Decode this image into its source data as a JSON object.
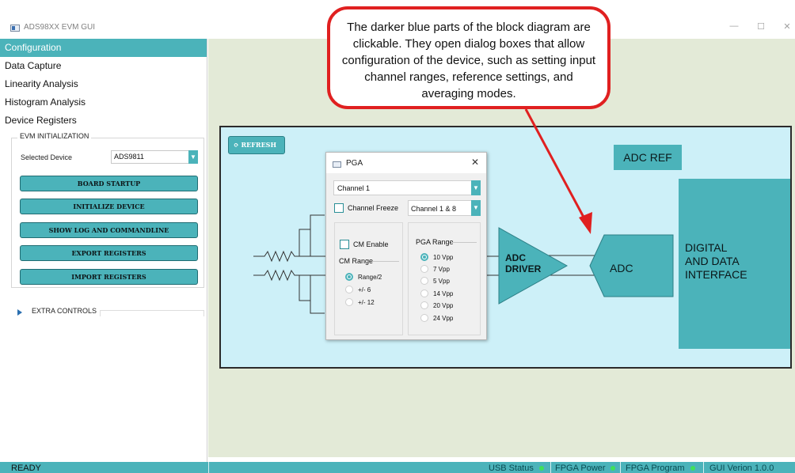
{
  "window": {
    "title": "ADS98XX EVM GUI",
    "minimize": "—",
    "maximize": "☐",
    "close": "✕"
  },
  "nav": {
    "items": [
      "Configuration",
      "Data Capture",
      "Linearity Analysis",
      "Histogram Analysis",
      "Device Registers"
    ],
    "active": "Configuration"
  },
  "evm_init": {
    "legend": "EVM INITIALIZATION",
    "selected_device_label": "Selected Device",
    "selected_device_value": "ADS9811",
    "buttons": [
      "BOARD STARTUP",
      "INITIALIZE DEVICE",
      "SHOW LOG AND COMMANDLINE",
      "EXPORT REGISTERS",
      "IMPORT REGISTERS"
    ]
  },
  "extra_controls": "EXTRA CONTROLS",
  "diagram": {
    "refresh": "REFRESH",
    "adc_ref": "ADC REF",
    "adc_driver": [
      "ADC",
      "DRIVER"
    ],
    "adc": "ADC",
    "digital": [
      "DIGITAL",
      "AND DATA",
      "INTERFACE"
    ]
  },
  "pga_dialog": {
    "title": "PGA",
    "close": "✕",
    "channel": "Channel 1",
    "channel_freeze": "Channel Freeze",
    "channel_pair": "Channel 1 & 8",
    "cm_enable": "CM Enable",
    "cm_range_label": "CM Range",
    "cm_range_options": [
      "Range/2",
      "+/- 6",
      "+/- 12"
    ],
    "cm_range_selected": "Range/2",
    "pga_range_label": "PGA Range",
    "pga_range_options": [
      "10 Vpp",
      "7 Vpp",
      "5 Vpp",
      "14 Vpp",
      "20 Vpp",
      "24 Vpp"
    ],
    "pga_range_selected": "10 Vpp"
  },
  "callout": "The darker blue parts of the block diagram are clickable. They open dialog boxes that allow configuration of the device, such as setting input channel ranges, reference settings, and averaging modes.",
  "status": {
    "ready": "READY",
    "usb": "USB Status",
    "fpga_power": "FPGA Power",
    "fpga_program": "FPGA Program",
    "gui_version": "GUI Verion 1.0.0"
  },
  "colors": {
    "accent": "#4bb3ba",
    "diagram_bg": "#cdf0f8",
    "canvas_bg": "#e3ead7",
    "callout_border": "#e02020",
    "led": "#3fe05a"
  }
}
